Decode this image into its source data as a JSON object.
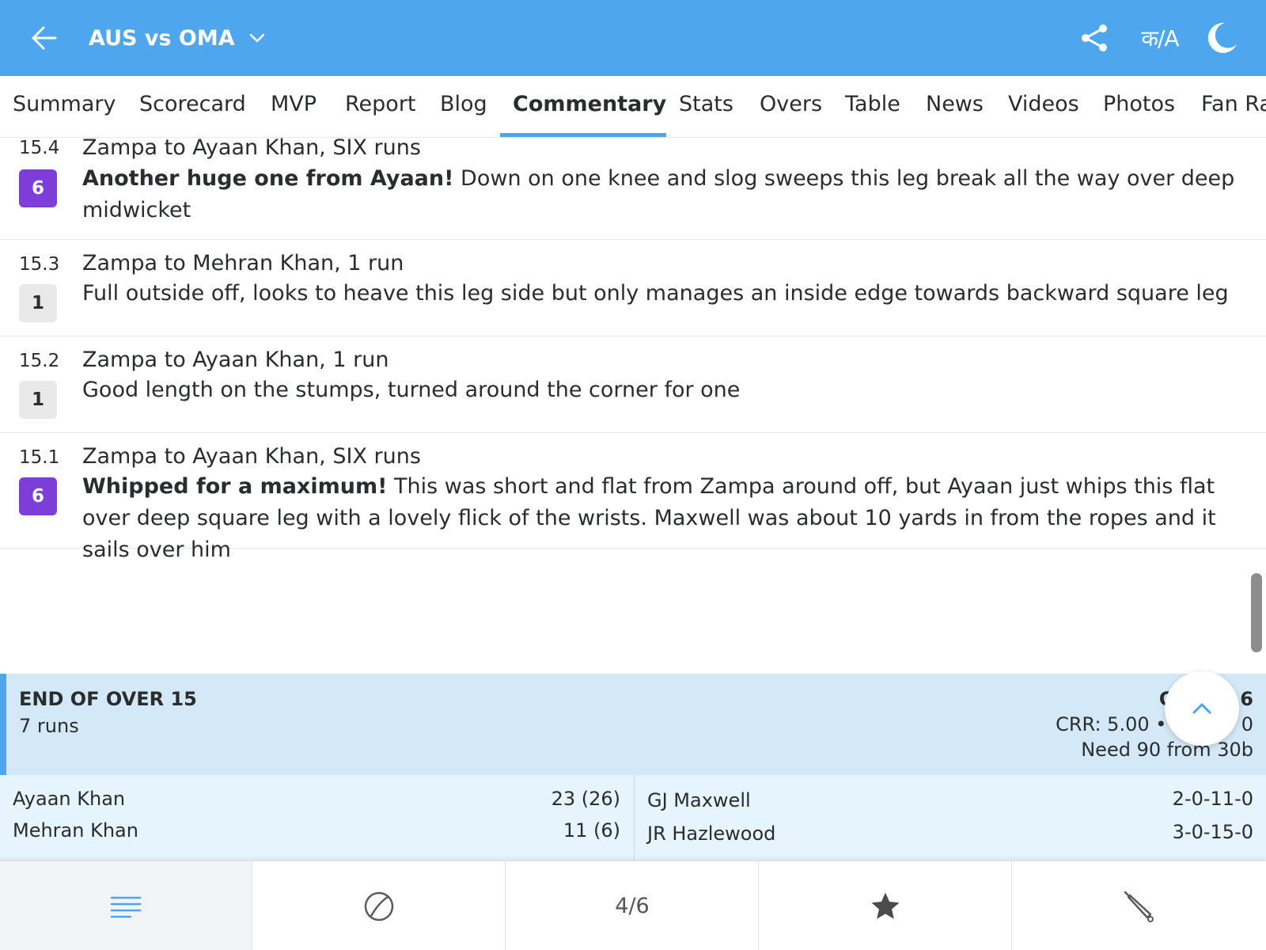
{
  "header": {
    "title": "AUS vs OMA",
    "lang_label": "क/A",
    "back_icon": "arrow-left-icon",
    "share_icon": "share-icon",
    "theme_icon": "moon-icon",
    "accent_color": "#4da6ee"
  },
  "tabs": [
    {
      "label": "Summary"
    },
    {
      "label": "Scorecard"
    },
    {
      "label": "MVP"
    },
    {
      "label": "Report"
    },
    {
      "label": "Blog"
    },
    {
      "label": "Commentary",
      "active": true
    },
    {
      "label": "Stats"
    },
    {
      "label": "Overs"
    },
    {
      "label": "Table"
    },
    {
      "label": "News"
    },
    {
      "label": "Videos"
    },
    {
      "label": "Photos"
    },
    {
      "label": "Fan Ra"
    }
  ],
  "commentary": [
    {
      "over": "15.4",
      "runs": "6",
      "title": "Zampa to Ayaan Khan, SIX runs",
      "highlight": "Another huge one from Ayaan!",
      "text": "Down on one knee and slog sweeps this leg break all the way over deep midwicket"
    },
    {
      "over": "15.3",
      "runs": "1",
      "title": "Zampa to Mehran Khan, 1 run",
      "highlight": "",
      "text": "Full outside off, looks to heave this leg side but only manages an inside edge towards backward square leg"
    },
    {
      "over": "15.2",
      "runs": "1",
      "title": "Zampa to Ayaan Khan, 1 run",
      "highlight": "",
      "text": "Good length on the stumps, turned around the corner for one"
    },
    {
      "over": "15.1",
      "runs": "6",
      "title": "Zampa to Ayaan Khan, SIX runs",
      "highlight": "Whipped for a maximum!",
      "text": "This was short and flat from Zampa around off, but Ayaan just whips this flat over deep square leg with a lovely flick of the wrists. Maxwell was about 10 yards in from the ropes and it sails over him"
    }
  ],
  "end_of_over": {
    "title": "END OF OVER 15",
    "runs": "7 runs",
    "score_partial": "O",
    "score_tail": "6",
    "rates_partial": "CRR: 5.00 • R",
    "rates_tail": "0",
    "need": "Need 90 from 30b",
    "batters": [
      {
        "name": "Ayaan Khan",
        "score": "23 (26)"
      },
      {
        "name": "Mehran Khan",
        "score": "11 (6)"
      }
    ],
    "bowlers": [
      {
        "name": "GJ Maxwell",
        "figures": "2-0-11-0"
      },
      {
        "name": "JR Hazlewood",
        "figures": "3-0-15-0"
      }
    ]
  },
  "bottom_nav": {
    "items": [
      {
        "icon": "list-icon"
      },
      {
        "icon": "ball-icon"
      },
      {
        "label": "4/6"
      },
      {
        "icon": "star-icon"
      },
      {
        "icon": "cricket-bat-icon"
      }
    ]
  },
  "colors": {
    "six_badge": "#7c3dd8",
    "run_badge": "#e9e9e9",
    "eoo_bg": "#d4e9f8"
  }
}
